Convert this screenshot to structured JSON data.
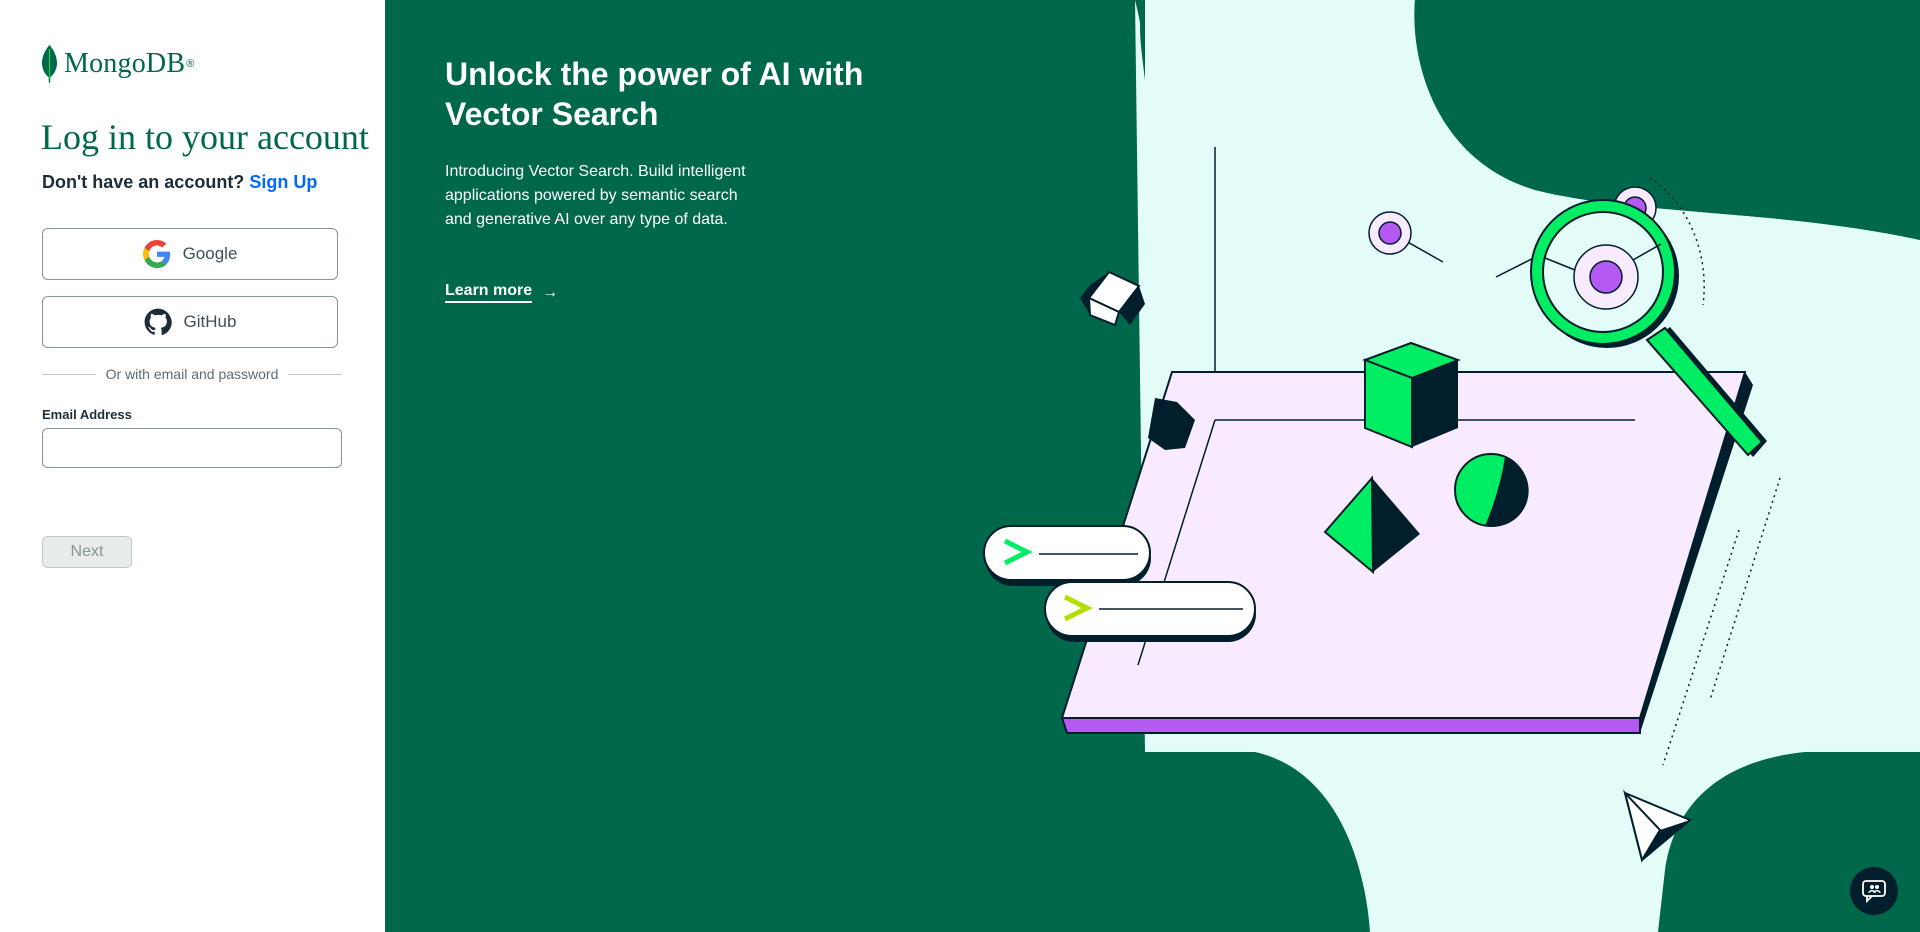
{
  "brand": {
    "name": "MongoDB",
    "registered": "®",
    "color": "#00684a"
  },
  "login": {
    "title": "Log in to your account",
    "signup_prompt": "Don't have an account?",
    "signup_link": "Sign Up",
    "google_label": "Google",
    "github_label": "GitHub",
    "divider_text": "Or with email and password",
    "email_label": "Email Address",
    "email_value": "",
    "email_placeholder": "",
    "next_label": "Next"
  },
  "hero": {
    "title": "Unlock the power of AI with Vector Search",
    "description": "Introducing Vector Search. Build intelligent applications powered by semantic search and generative AI over any type of data.",
    "learn_more": "Learn more",
    "learn_more_arrow": "→",
    "background_color": "#00684a",
    "blob_color": "#e3fcf7",
    "accent_green": "#00ed64",
    "accent_purple": "#b45af2",
    "platform_color": "#f9ebff"
  },
  "icons": {
    "logo": "mongodb-leaf-icon",
    "google": "google-icon",
    "github": "github-icon",
    "chat": "chat-support-icon"
  }
}
